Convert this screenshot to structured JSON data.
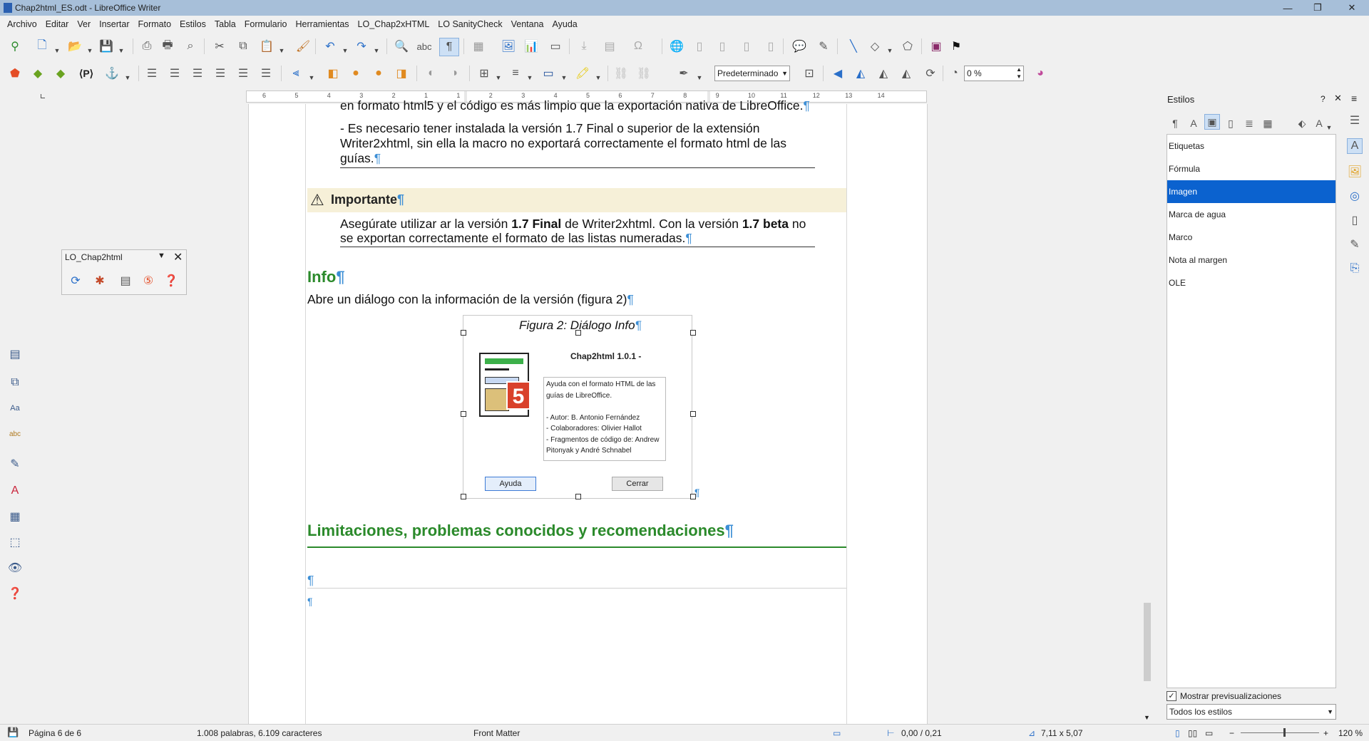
{
  "window": {
    "title": "Chap2html_ES.odt - LibreOffice Writer"
  },
  "menu": [
    "Archivo",
    "Editar",
    "Ver",
    "Insertar",
    "Formato",
    "Estilos",
    "Tabla",
    "Formulario",
    "Herramientas",
    "LO_Chap2xHTML",
    "LO SanityCheck",
    "Ventana",
    "Ayuda"
  ],
  "toolbar2": {
    "paragraph_style": "Predeterminado",
    "transparency": "0 %"
  },
  "ruler": {
    "ticks": [
      "6",
      "5",
      "4",
      "3",
      "2",
      "1",
      "1",
      "2",
      "3",
      "4",
      "5",
      "6",
      "7",
      "8",
      "9",
      "10",
      "11",
      "12",
      "13",
      "14"
    ]
  },
  "floating_toolbar": {
    "title": "LO_Chap2html"
  },
  "document": {
    "line1": "en formato html5 y el código es más limpio que la exportación nativa de LibreOffice.",
    "bullet1_line1": "- Es necesario tener instalada la versión 1.7 Final o superior de la extensión",
    "bullet1_line2": "Writer2xhtml, sin ella la macro no exportará correctamente el formato html de las",
    "bullet1_line3": "guías.",
    "important_title": "Importante",
    "important_line1_a": "Asegúrate utilizar ar la versión ",
    "important_line1_b": "1.7 Final",
    "important_line1_c": " de Writer2xhtml. Con la versión ",
    "important_line1_d": "1.7 beta",
    "important_line1_e": " no",
    "important_line2": "se exportan correctamente el formato de las listas numeradas.",
    "heading_info": "Info",
    "info_text": "Abre un diálogo con la información de la versión (figura 2)",
    "caption": "Figura 2: Diálogo Info",
    "heading_limitations": "Limitaciones, problemas conocidos y recomendaciones",
    "pilcrow": "¶"
  },
  "figure_dialog": {
    "title": "Chap2html 1.0.1 -",
    "badge": "5",
    "text_lines": [
      "Ayuda con el formato HTML de las",
      "guías de LibreOffice.",
      "",
      "- Autor: B. Antonio Fernández",
      "- Colaboradores: Olivier Hallot",
      "- Fragmentos de código de: Andrew",
      "Pitonyak y André Schnabel"
    ],
    "help_button": "Ayuda",
    "close_button": "Cerrar"
  },
  "sidebar": {
    "title": "Estilos",
    "styles": [
      "Etiquetas",
      "Fórmula",
      "Imagen",
      "Marca de agua",
      "Marco",
      "Nota al margen",
      "OLE"
    ],
    "selected_index": 2,
    "show_previews_label": "Mostrar previsualizaciones",
    "show_previews_checked": true,
    "filter_value": "Todos los estilos"
  },
  "status": {
    "page": "Página 6 de 6",
    "words": "1.008 palabras, 6.109 caracteres",
    "page_style": "Front Matter",
    "position": "0,00 / 0,21",
    "size": "7,11 x 5,07",
    "zoom": "120 %"
  },
  "colors": {
    "accent": "#0b62cf",
    "heading": "#2b8a2b",
    "titlebar": "#a7bfd9",
    "note_bg": "#f6f0d8",
    "badge": "#d9412b"
  }
}
